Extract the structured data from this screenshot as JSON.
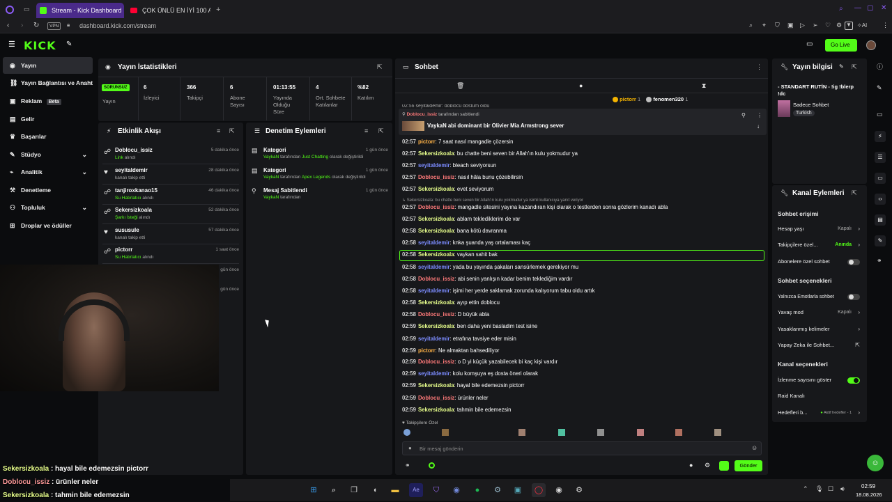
{
  "browser": {
    "tabs": [
      {
        "label": "Stream - Kick Dashboard"
      },
      {
        "label": "ÇOK ÜNLÜ EN İYİ 100 ANIM"
      }
    ],
    "vpn_label": "VPN",
    "url": "dashboard.kick.com/stream",
    "ai_label": "AI"
  },
  "header": {
    "logo": "KICK",
    "go_live": "Go Live"
  },
  "sidebar": {
    "items": [
      {
        "label": "Yayın",
        "icon": "broadcast-icon"
      },
      {
        "label": "Yayın Bağlantısı ve Anahtar",
        "icon": "link-icon"
      },
      {
        "label": "Reklam",
        "badge": "Beta",
        "icon": "ad-icon"
      },
      {
        "label": "Gelir",
        "icon": "money-icon"
      },
      {
        "label": "Başarılar",
        "icon": "trophy-icon"
      },
      {
        "label": "Stüdyo",
        "icon": "studio-icon"
      },
      {
        "label": "Analitik",
        "icon": "analytics-icon"
      },
      {
        "label": "Denetleme",
        "icon": "hammer-icon"
      },
      {
        "label": "Topluluk",
        "icon": "community-icon"
      },
      {
        "label": "Droplar ve ödüller",
        "icon": "gift-icon"
      }
    ]
  },
  "stats": {
    "title": "Yayın İstatistikleri",
    "status_badge": "SORUNSUZ",
    "status_label": "Yayın",
    "items": [
      {
        "value": "6",
        "label": "İzleyici"
      },
      {
        "value": "366",
        "label": "Takipçi"
      },
      {
        "value": "6",
        "label": "Abone Sayısı"
      },
      {
        "value": "01:13:55",
        "label": "Yayında Olduğu Süre"
      },
      {
        "value": "4",
        "label": "Ort. Sohbete Katılanlar"
      },
      {
        "value": "%82",
        "label": "Katılım"
      }
    ]
  },
  "activity": {
    "title": "Etkinlik Akışı",
    "items": [
      {
        "name": "Doblocu_issiz",
        "sub_hl": "Link",
        "sub": "alındı",
        "time": "5 dakika önce"
      },
      {
        "name": "seyitaldemir",
        "sub_hl": "",
        "sub": "kanalı takip etti",
        "time": "28 dakika önce"
      },
      {
        "name": "tanjiroxkanao15",
        "sub_hl": "Su Hatırlatıcı",
        "sub": "alındı",
        "time": "46 dakika önce"
      },
      {
        "name": "Sekersizkoala",
        "sub_hl": "Şarkı İsteği",
        "sub": "alındı",
        "time": "52 dakika önce"
      },
      {
        "name": "sususule",
        "sub_hl": "",
        "sub": "kanalı takip etti",
        "time": "57 dakika önce"
      },
      {
        "name": "pictorr",
        "sub_hl": "Su Hatırlatıcı",
        "sub": "alındı",
        "time": "1 saat önce"
      }
    ],
    "extra_times": [
      "gün önce",
      "gün önce"
    ]
  },
  "moderation": {
    "title": "Denetim Eylemleri",
    "items": [
      {
        "title": "Kategori",
        "actor": "VaykaN",
        "mid": " tarafından ",
        "hl": "Just Chatting",
        "end": " olarak değiştirildi",
        "time": "1 gün önce"
      },
      {
        "title": "Kategori",
        "actor": "VaykaN",
        "mid": " tarafından ",
        "hl": "Apex Legends",
        "end": " olarak değiştirildi",
        "time": "1 gün önce"
      },
      {
        "title": "Mesaj Sabitlendi",
        "actor": "VaykaN",
        "mid": " tarafından",
        "hl": "",
        "end": "",
        "time": "1 gün önce"
      }
    ]
  },
  "chat": {
    "title": "Sohbet",
    "top_users": [
      {
        "name": "pictorr",
        "count": "1"
      },
      {
        "name": "fenomen320",
        "count": "1"
      }
    ],
    "pinned_header_user": "Doblocu_issiz",
    "pinned_header_text": " tarafından sabitlendi",
    "pinned_msg": "VaykaN abi dominant bir Olivier Mia Armstrong sever",
    "partial_top": "02:56 seyitaldemir: doblocu dostum oldu",
    "reply_note": "↳ Sekersizkoala: bu chatte beni seven bir Allah'ın kulu yokmudur ya isimli kullanıcıya yanıt veriyor",
    "messages": [
      {
        "t": "02:57",
        "u": "pictorr",
        "c": "n4",
        "m": ": 7 saat nasıl mangadle çözersin"
      },
      {
        "t": "02:57",
        "u": "Sekersizkoala",
        "c": "n1",
        "m": ": bu chatte beni seven bir Allah'ın kulu yokmudur ya"
      },
      {
        "t": "02:57",
        "u": "seyitaldemir",
        "c": "n2",
        "m": ": bleach seviyorsun"
      },
      {
        "t": "02:57",
        "u": "Doblocu_issiz",
        "c": "n3",
        "m": ": nasıl hâla bunu çözebilirsin"
      },
      {
        "t": "02:57",
        "u": "Sekersizkoala",
        "c": "n1",
        "m": ": evet seviyorum"
      },
      {
        "t": "02:57",
        "u": "Doblocu_issiz",
        "c": "n3",
        "m": ": mangadle sitesini yayına kazandıran kişi olarak o testlerden sonra gözlerim kanadı abla"
      },
      {
        "t": "02:57",
        "u": "Sekersizkoala",
        "c": "n1",
        "m": ": ablam teklediklerim de var"
      },
      {
        "t": "02:58",
        "u": "Sekersizkoala",
        "c": "n1",
        "m": ": bana kötü davranma"
      },
      {
        "t": "02:58",
        "u": "seyitaldemir",
        "c": "n2",
        "m": ": knka şuanda yaş ortalaması kaç"
      },
      {
        "t": "02:58",
        "u": "Sekersizkoala",
        "c": "n1",
        "m": ": vaykan sahit bak"
      },
      {
        "t": "02:58",
        "u": "seyitaldemir",
        "c": "n2",
        "m": ": yada bu yayında şakaları sansürlemek gerekiyor mu"
      },
      {
        "t": "02:58",
        "u": "Doblocu_issiz",
        "c": "n3",
        "m": ": abi senin yanlışın kadar benim teklediğim vardır"
      },
      {
        "t": "02:58",
        "u": "seyitaldemir",
        "c": "n2",
        "m": ": işimi her yerde saklamak zorunda kalıyorum tabu oldu artık"
      },
      {
        "t": "02:58",
        "u": "Sekersizkoala",
        "c": "n1",
        "m": ": ayıp ettin doblocu"
      },
      {
        "t": "02:58",
        "u": "Doblocu_issiz",
        "c": "n3",
        "m": ": D büyük abla"
      },
      {
        "t": "02:59",
        "u": "Sekersizkoala",
        "c": "n1",
        "m": ": ben daha yeni basladim test isine"
      },
      {
        "t": "02:59",
        "u": "seyitaldemir",
        "c": "n2",
        "m": ": etrafına tavsiye eder misin"
      },
      {
        "t": "02:59",
        "u": "pictorr",
        "c": "n4",
        "m": ": Ne almaktan bahsediliyor"
      },
      {
        "t": "02:59",
        "u": "Doblocu_issiz",
        "c": "n3",
        "m": ": o D yi küçük yazabilecek bi kaç kişi vardır"
      },
      {
        "t": "02:59",
        "u": "seyitaldemir",
        "c": "n2",
        "m": ": kolu komşuya eş dosta öneri olarak"
      },
      {
        "t": "02:59",
        "u": "Sekersizkoala",
        "c": "n1",
        "m": ": hayal bile edemezsin pictorr"
      },
      {
        "t": "02:59",
        "u": "Doblocu_issiz",
        "c": "n3",
        "m": ": ürünler neler"
      },
      {
        "t": "02:59",
        "u": "Sekersizkoala",
        "c": "n1",
        "m": ": tahmin bile edemezsin"
      }
    ],
    "followers_only": "Takipçilere Özel",
    "input_placeholder": "Bir mesaj gönderin",
    "send": "Gönder"
  },
  "stream_info": {
    "title": "Yayın bilgisi",
    "stream_title": "- STANDART RUTİN - !ig !blerp !dc",
    "category": "Sadece Sohbet",
    "tag": "Turkish"
  },
  "channel_actions": {
    "title": "Kanal Eylemleri",
    "chat_access": "Sohbet erişimi",
    "account_age": "Hesap yaşı",
    "account_age_val": "Kapalı",
    "followers_special": "Takipçilere özel...",
    "followers_special_val": "Anında",
    "subs_chat": "Abonelere özel sohbet",
    "chat_options": "Sohbet seçenekleri",
    "emote_only": "Yalnızca Emotlarla sohbet",
    "slow_mode": "Yavaş mod",
    "slow_mode_val": "Kapalı",
    "banned_words": "Yasaklanmış kelimeler",
    "ai_chat": "Yapay Zeka ile Sohbet...",
    "channel_options": "Kanal seçenekleri",
    "show_viewers": "İzlenme sayısını göster",
    "raid": "Raid Kanalı",
    "goals": "Hedefleri b...",
    "goals_val": "Aktif hedefler - 1"
  },
  "overlay_chat": [
    {
      "user": "Sekersizkoala",
      "msg": " : hayal bile edemezsin pictorr"
    },
    {
      "user": "Doblocu_issiz",
      "msg": " : ürünler neler"
    },
    {
      "user": "Sekersizkoala",
      "msg": " : tahmin bile edemezsin"
    }
  ],
  "taskbar": {
    "time": "02:59",
    "date": "18.08.2026"
  },
  "colors": {
    "accent": "#53fc18",
    "panel": "#17181b",
    "bg": "#0b0c0e"
  }
}
